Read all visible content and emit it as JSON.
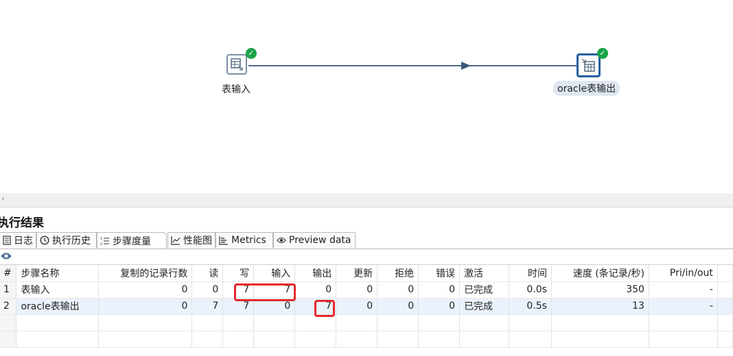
{
  "canvas": {
    "step1": {
      "label": "表输入",
      "status_icon": "check-icon"
    },
    "step2": {
      "label": "oracle表输出",
      "status_icon": "check-icon"
    }
  },
  "panel": {
    "title": "执行结果",
    "tabs": [
      {
        "label": "日志",
        "icon": "log-icon"
      },
      {
        "label": "执行历史",
        "icon": "history-icon"
      },
      {
        "label": "步骤度量",
        "icon": "metrics-list-icon",
        "active": true
      },
      {
        "label": "性能图",
        "icon": "chart-icon"
      },
      {
        "label": "Metrics",
        "icon": "metrics-icon"
      },
      {
        "label": "Preview data",
        "icon": "eye-icon"
      }
    ]
  },
  "table": {
    "headers": [
      "#",
      "步骤名称",
      "复制的记录行数",
      "读",
      "写",
      "输入",
      "输出",
      "更新",
      "拒绝",
      "错误",
      "激活",
      "时间",
      "速度 (条记录/秒)",
      "Pri/in/out"
    ],
    "rows": [
      [
        "1",
        "表输入",
        "0",
        "0",
        "7",
        "7",
        "0",
        "0",
        "0",
        "0",
        "已完成",
        "0.0s",
        "350",
        "-"
      ],
      [
        "2",
        "oracle表输出",
        "0",
        "7",
        "7",
        "0",
        "7",
        "0",
        "0",
        "0",
        "已完成",
        "0.5s",
        "13",
        "-"
      ]
    ]
  },
  "colors": {
    "highlight": "#e5282b",
    "success": "#1aa34a",
    "hop": "#3c5a78"
  }
}
